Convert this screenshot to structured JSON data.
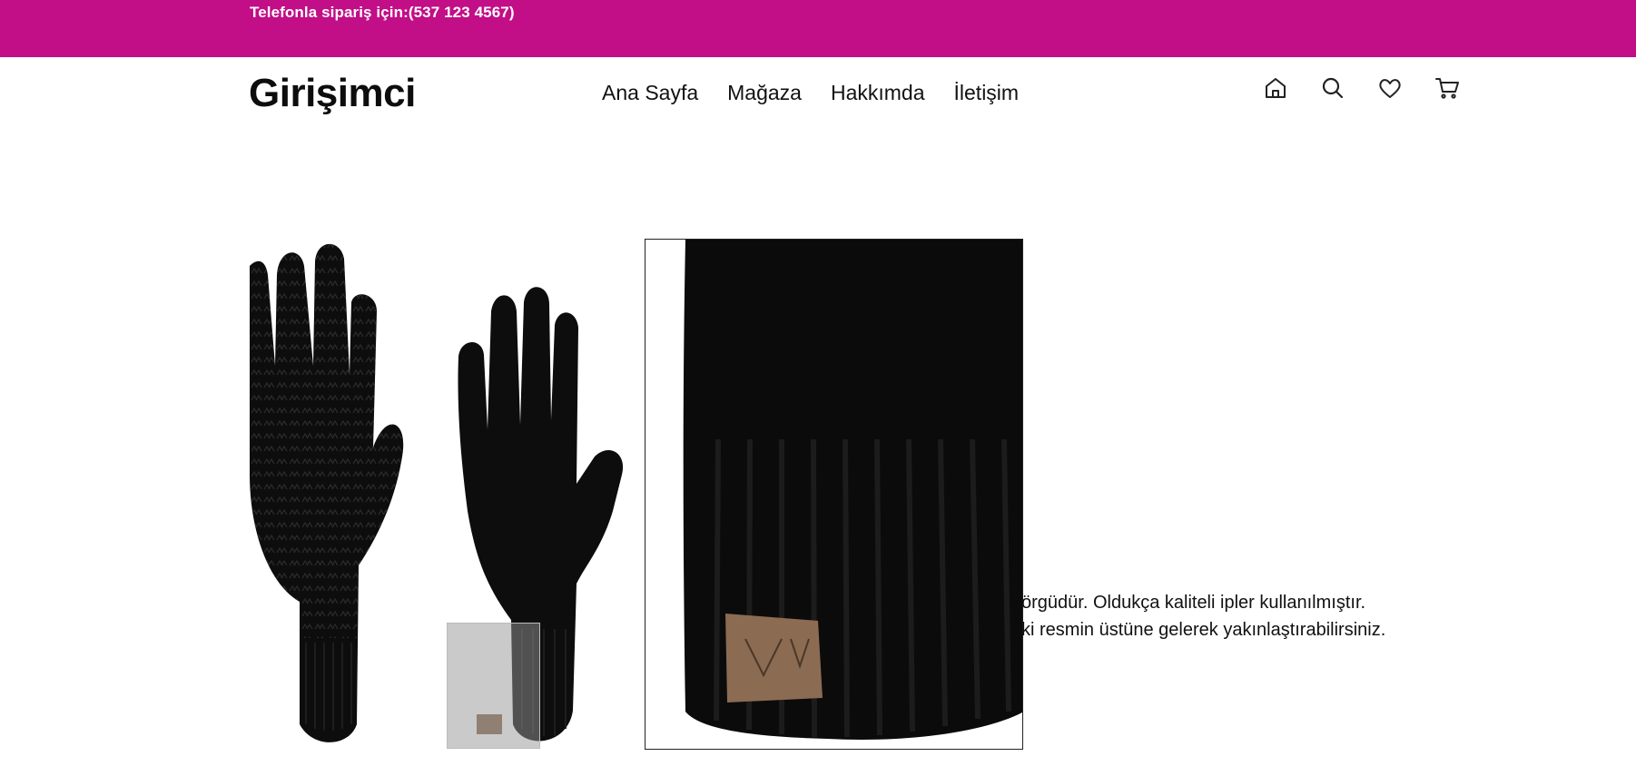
{
  "topbar": {
    "phone_text": "Telefonla sipariş için:(537 123 4567)",
    "background_color": "#c20e87"
  },
  "header": {
    "logo": "Girişimci",
    "nav": [
      {
        "label": "Ana Sayfa"
      },
      {
        "label": "Mağaza"
      },
      {
        "label": "Hakkımda"
      },
      {
        "label": "İletişim"
      }
    ],
    "icons": [
      "home-icon",
      "search-icon",
      "heart-icon",
      "cart-icon"
    ]
  },
  "product": {
    "image": "black-knit-gloves",
    "zoom_image": "glove-cuff-closeup",
    "description_lines": [
      "örgüdür. Oldukça kaliteli ipler kullanılmıştır.",
      "ki resmin üstüne gelerek yakınlaştırabilirsiniz."
    ]
  }
}
